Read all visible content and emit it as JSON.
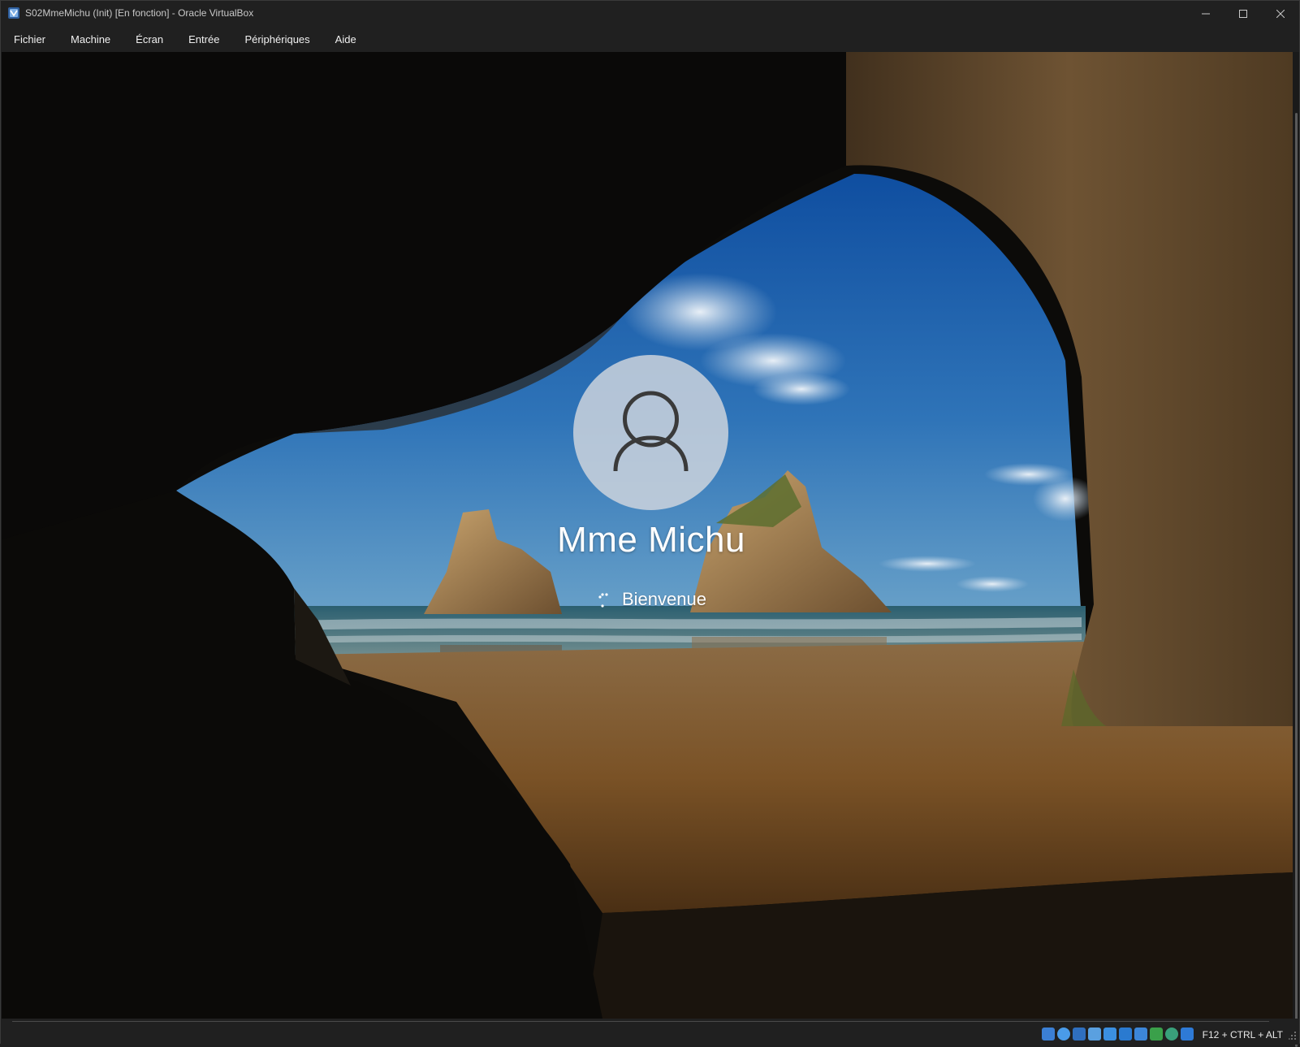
{
  "window": {
    "title": "S02MmeMichu (Init) [En fonction] - Oracle VirtualBox",
    "icon": "virtualbox-icon"
  },
  "menu": {
    "items": [
      {
        "label": "Fichier"
      },
      {
        "label": "Machine"
      },
      {
        "label": "Écran"
      },
      {
        "label": "Entrée"
      },
      {
        "label": "Périphériques"
      },
      {
        "label": "Aide"
      }
    ]
  },
  "login_screen": {
    "user_name": "Mme Michu",
    "status_text": "Bienvenue",
    "avatar_icon": "user-icon",
    "spinner_icon": "loading-spinner-icon"
  },
  "status_bar": {
    "host_key": "F12 + CTRL + ALT",
    "icons": [
      "hard-disk-icon",
      "optical-drive-icon",
      "network-icon",
      "usb-icon",
      "shared-folders-icon",
      "display-icon",
      "video-capture-icon",
      "cpu-icon",
      "mouse-integration-icon",
      "keyboard-icon"
    ]
  },
  "colors": {
    "chrome_bg": "#202020",
    "chrome_text": "#f0f0f0",
    "title_text": "#c8c8c8",
    "avatar_bg": "#d2d7de",
    "sky": "#1e5ea8",
    "sand": "#8a5a2a"
  }
}
